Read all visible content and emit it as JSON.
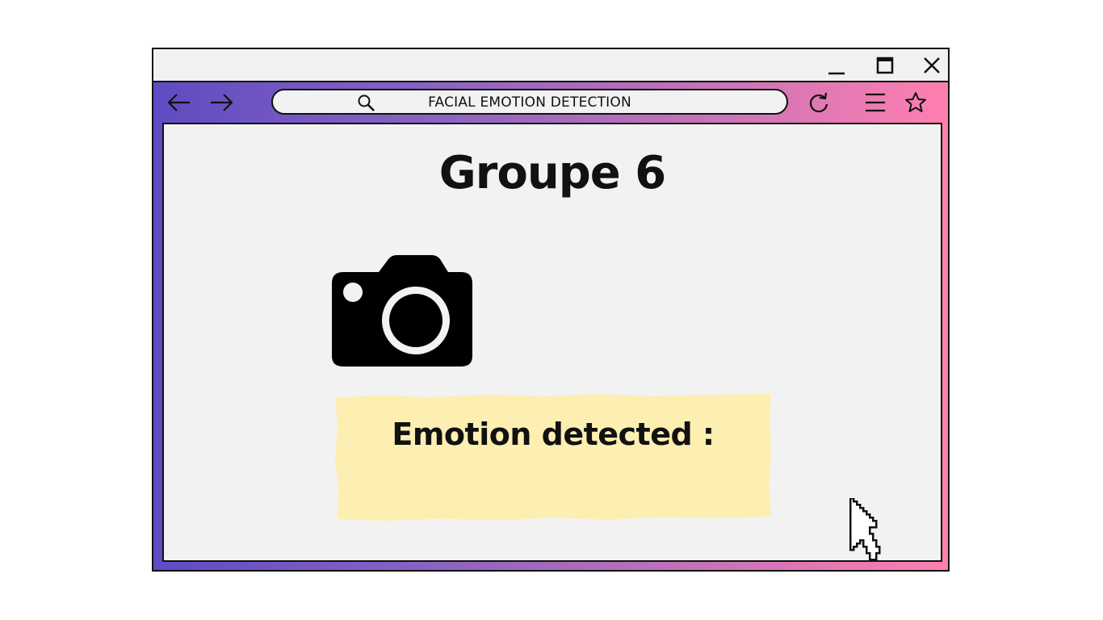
{
  "browser": {
    "address": {
      "text": "FACIAL EMOTION DETECTION",
      "icon": "search-icon"
    },
    "titlebar": {
      "buttons": [
        "minimize-icon",
        "maximize-icon",
        "close-icon"
      ]
    },
    "toolbar": {
      "left_icons": [
        "arrow-left-icon",
        "arrow-right-icon"
      ],
      "right_icons": [
        "refresh-icon",
        "menu-icon",
        "star-icon"
      ]
    },
    "colors": {
      "gradient_start": "#5f4bc2",
      "gradient_end": "#ff7fb0",
      "content_bg": "#f2f2f2"
    }
  },
  "page": {
    "title": "Groupe 6",
    "camera_icon": "camera-icon",
    "result": {
      "label": "Emotion detected :",
      "value": "",
      "background": "#fdeeb2"
    },
    "cursor_icon": "pointer-cursor-icon"
  }
}
